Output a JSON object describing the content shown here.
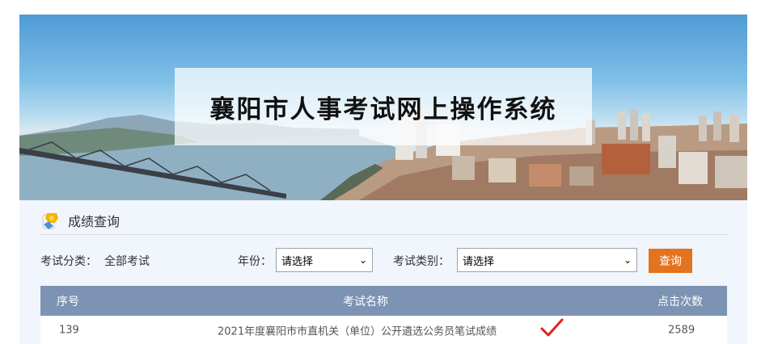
{
  "banner": {
    "title": "襄阳市人事考试网上操作系统"
  },
  "section": {
    "title": "成绩查询",
    "icon": "trophy-doc-icon"
  },
  "filters": {
    "category_label": "考试分类：",
    "category_value": "全部考试",
    "year_label": "年份：",
    "year_value": "请选择",
    "type_label": "考试类别：",
    "type_value": "请选择",
    "query_button": "查询"
  },
  "table": {
    "columns": [
      "序号",
      "考试名称",
      "点击次数"
    ],
    "rows": [
      {
        "index": "139",
        "name": "2021年度襄阳市市直机关（单位）公开遴选公务员笔试成绩",
        "clicks": "2589",
        "mark": "check-icon"
      }
    ]
  },
  "colors": {
    "header_bg": "#7c93b3",
    "button_bg": "#e4731f",
    "panel_bg": "#f1f5fc",
    "check": "#e0201b"
  }
}
